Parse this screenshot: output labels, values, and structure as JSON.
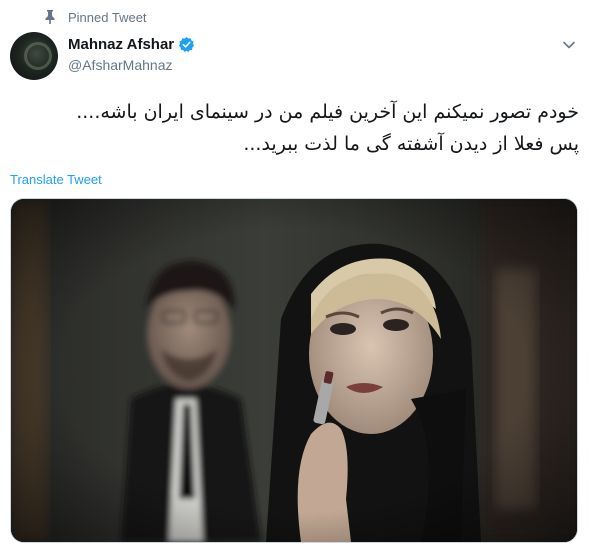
{
  "pinned": {
    "label": "Pinned Tweet",
    "icon": "pin-icon"
  },
  "user": {
    "display_name": "Mahnaz Afshar",
    "handle": "@AfsharMahnaz",
    "verified": true,
    "verified_color": "#1da1f2"
  },
  "tweet": {
    "lines": [
      "خودم تصور نمیکنم این آخرین فیلم من در سینمای ایران باشه....",
      "پس فعلا از دیدن آشفته گی ما لذت ببرید..."
    ]
  },
  "translate_label": "Translate Tweet",
  "media": {
    "icon": "photo-image"
  },
  "colors": {
    "link": "#1da1f2",
    "secondary_text": "#657786",
    "primary_text": "#14171a"
  }
}
